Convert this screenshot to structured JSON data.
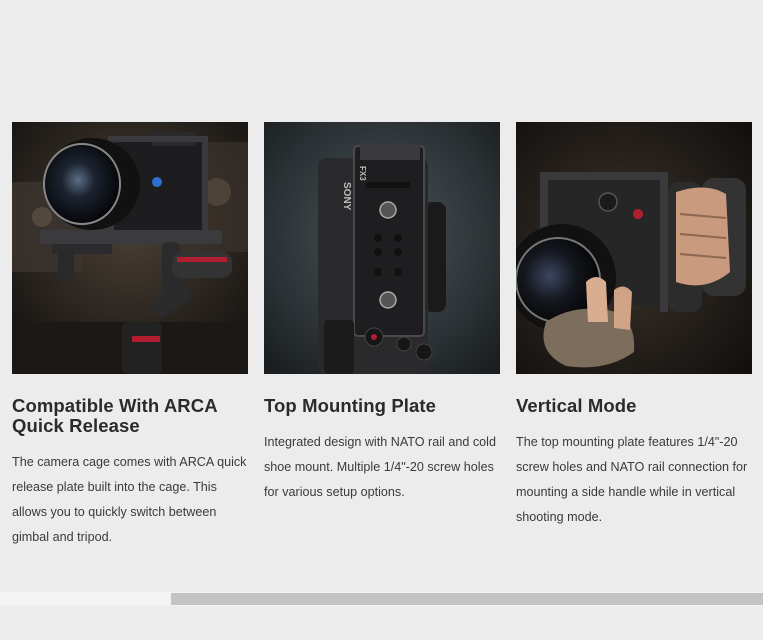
{
  "features": [
    {
      "title": "Compatible With ARCA Quick Release",
      "description": "The camera cage comes with ARCA quick release plate built into the cage. This allows you to quickly switch between gimbal and tripod.",
      "image_label": "camera-on-gimbal-photo"
    },
    {
      "title": "Top Mounting Plate",
      "description": "Integrated design with NATO rail and cold shoe mount. Multiple 1/4\"-20 screw holes for various setup options.",
      "image_label": "top-mounting-plate-photo",
      "image_text": {
        "brand": "SONY",
        "model": "FX3"
      }
    },
    {
      "title": "Vertical Mode",
      "description": "The top mounting plate features 1/4\"-20 screw holes and NATO rail connection for mounting a side handle while in vertical shooting mode.",
      "image_label": "vertical-mode-photo"
    }
  ],
  "colors": {
    "background": "#ececec",
    "heading": "#2b2b2b",
    "body_text": "#3a3a3a",
    "scrollbar_thumb": "#c4c4c4"
  },
  "scrollbar": {
    "position_fraction": 0.22
  }
}
